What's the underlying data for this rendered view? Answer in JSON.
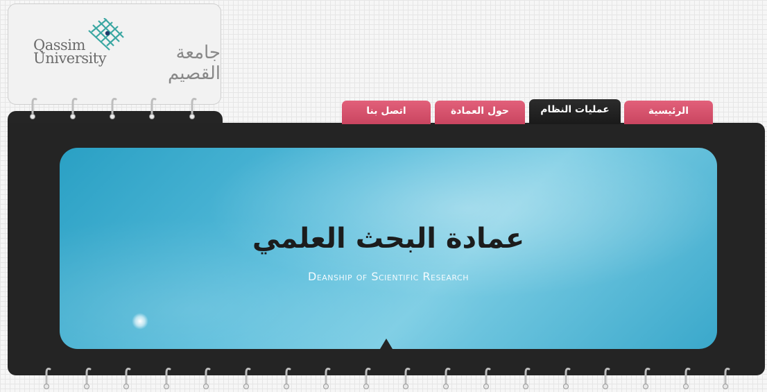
{
  "logo": {
    "english": "Qassim\nUniversity",
    "arabic": "جامعة القصيم",
    "icon": "qassim-lattice-logo-icon"
  },
  "nav": {
    "tabs": [
      {
        "label": "الرئيسية",
        "active": false
      },
      {
        "label": "عمليات النظام",
        "active": true
      },
      {
        "label": "حول العمادة",
        "active": false
      },
      {
        "label": "اتصل بنا",
        "active": false
      }
    ]
  },
  "banner": {
    "title_ar": "عمادة البحث العلمي",
    "title_en": "Deanship of Scientific Research"
  },
  "colors": {
    "tab_pink": "#d4506b",
    "tab_active": "#222222",
    "panel": "#242424",
    "banner_blue": "#4fb6d8"
  }
}
